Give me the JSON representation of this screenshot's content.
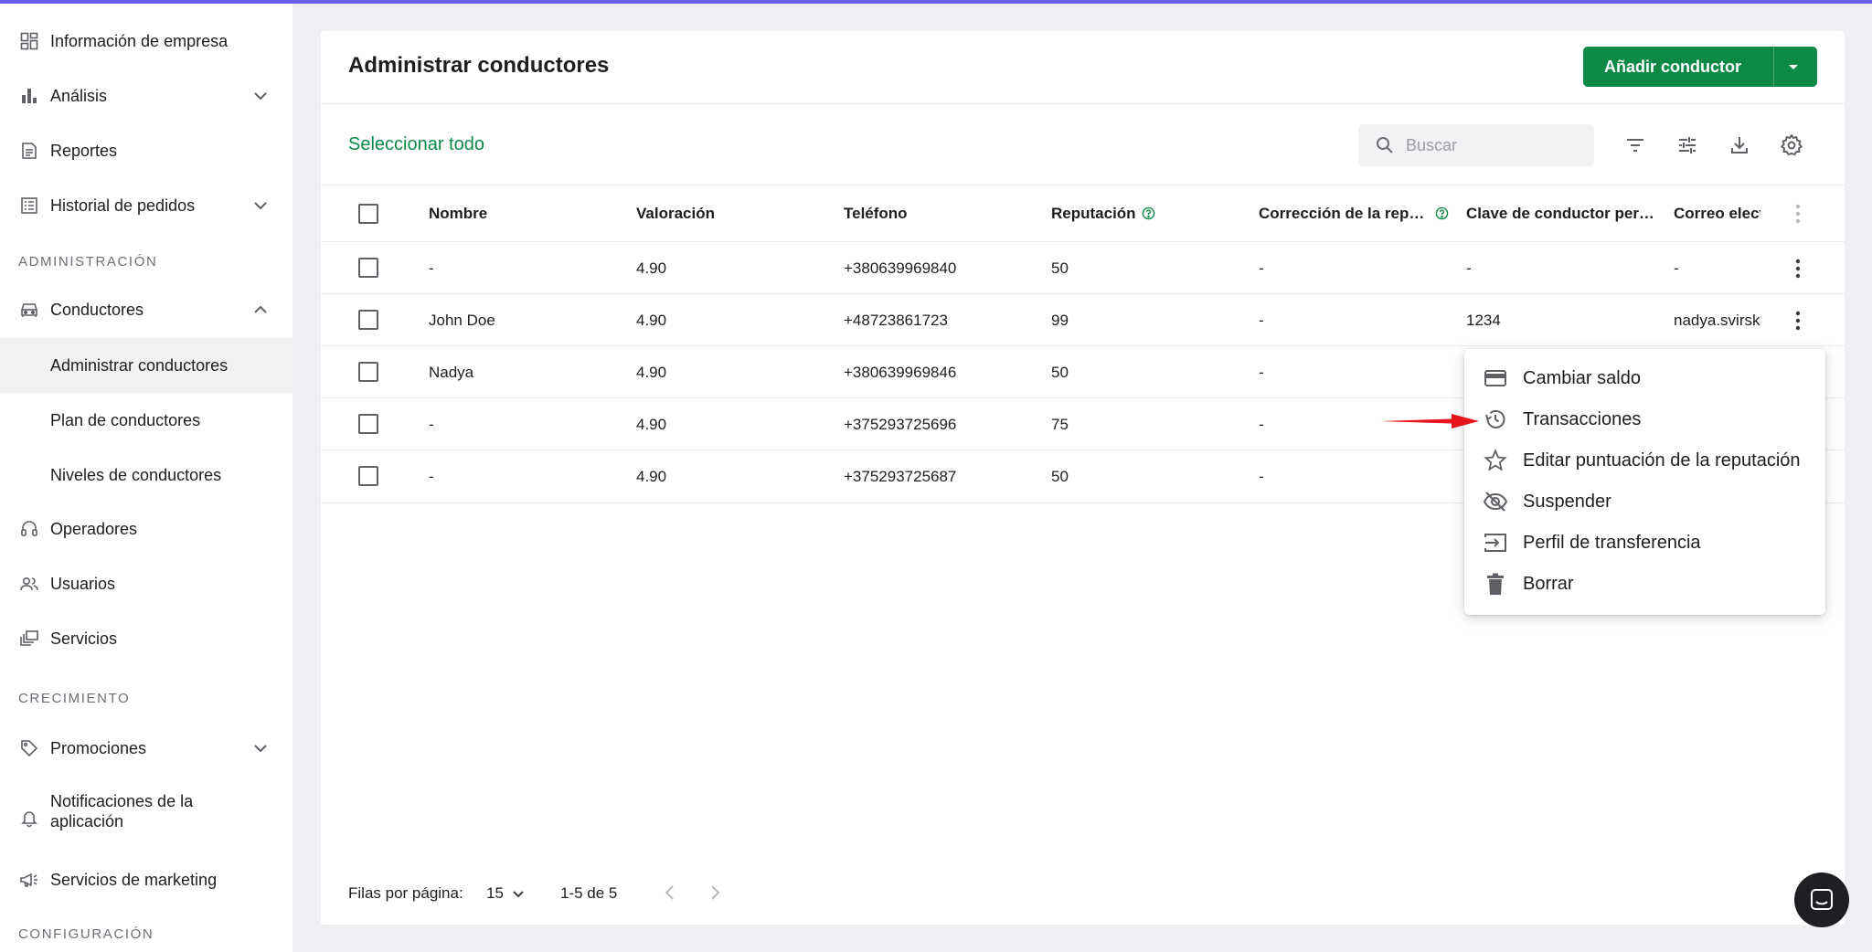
{
  "sidebar": {
    "items": [
      {
        "label": "Información de empresa",
        "icon": "dashboard-icon"
      },
      {
        "label": "Análisis",
        "icon": "bar-chart-icon",
        "expandable": true
      },
      {
        "label": "Reportes",
        "icon": "report-icon"
      },
      {
        "label": "Historial de pedidos",
        "icon": "list-icon",
        "expandable": true
      }
    ],
    "section_admin": "ADMINISTRACIÓN",
    "conductores": {
      "label": "Conductores",
      "icon": "car-icon",
      "expanded": true,
      "sub": [
        "Administrar conductores",
        "Plan de conductores",
        "Niveles de conductores"
      ]
    },
    "admin_items": [
      {
        "label": "Operadores",
        "icon": "headset-icon"
      },
      {
        "label": "Usuarios",
        "icon": "users-icon"
      },
      {
        "label": "Servicios",
        "icon": "services-icon"
      }
    ],
    "section_growth": "CRECIMIENTO",
    "growth_items": [
      {
        "label": "Promociones",
        "icon": "tag-icon",
        "expandable": true
      },
      {
        "label": "Notificaciones de la aplicación",
        "icon": "bell-icon"
      },
      {
        "label": "Servicios de marketing",
        "icon": "megaphone-icon"
      }
    ],
    "section_config": "CONFIGURACIÓN"
  },
  "header": {
    "title": "Administrar conductores",
    "add_button": "Añadir conductor"
  },
  "toolbar": {
    "select_all": "Seleccionar todo",
    "search_placeholder": "Buscar"
  },
  "table": {
    "columns": [
      "Nombre",
      "Valoración",
      "Teléfono",
      "Reputación",
      "Corrección de la rep…",
      "Clave de conductor per…",
      "Correo elect"
    ],
    "rows": [
      [
        "-",
        "4.90",
        "+380639969840",
        "50",
        "-",
        "-",
        "-"
      ],
      [
        "John Doe",
        "4.90",
        "+48723861723",
        "99",
        "-",
        "1234",
        "nadya.svirsk"
      ],
      [
        "Nadya",
        "4.90",
        "+380639969846",
        "50",
        "-",
        "",
        ""
      ],
      [
        "-",
        "4.90",
        "+375293725696",
        "75",
        "-",
        "",
        ""
      ],
      [
        "-",
        "4.90",
        "+375293725687",
        "50",
        "-",
        "",
        ""
      ]
    ]
  },
  "menu": {
    "items": [
      {
        "label": "Cambiar saldo",
        "icon": "credit-card-icon"
      },
      {
        "label": "Transacciones",
        "icon": "history-icon"
      },
      {
        "label": "Editar puntuación de la reputación",
        "icon": "star-icon"
      },
      {
        "label": "Suspender",
        "icon": "eye-off-icon"
      },
      {
        "label": "Perfil de transferencia",
        "icon": "transfer-icon"
      },
      {
        "label": "Borrar",
        "icon": "trash-icon"
      }
    ]
  },
  "footer": {
    "rows_label": "Filas por página:",
    "rows_value": "15",
    "range": "1-5 de 5"
  },
  "colors": {
    "accent": "#0c8a45",
    "top_line": "#6c5ce7",
    "annotation_arrow": "#e8141b"
  }
}
